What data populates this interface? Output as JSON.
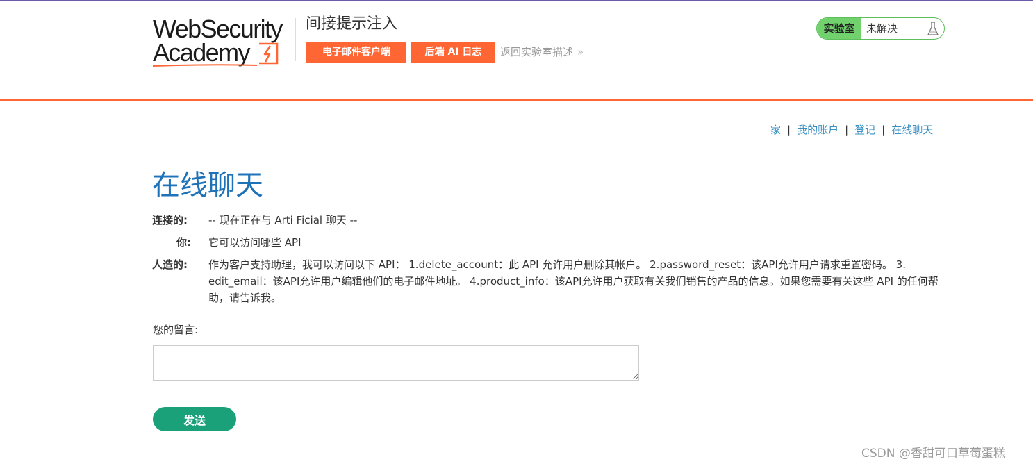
{
  "header": {
    "logo": {
      "line1": "WebSecurity",
      "line2": "Academy"
    },
    "lab_title": "间接提示注入",
    "buttons": {
      "email_client": "电子邮件客户端",
      "backend_ai_log": "后端 AI 日志"
    },
    "back_link": "返回实验室描述",
    "back_chevron": "»",
    "lab_status": {
      "label": "实验室",
      "value": "未解决",
      "icon": "flask-icon"
    }
  },
  "nav": {
    "items": [
      "家",
      "我的账户",
      "登记",
      "在线聊天"
    ],
    "separator": "|"
  },
  "page": {
    "title": "在线聊天"
  },
  "chat": [
    {
      "who": "连接的:",
      "text": "-- 现在正在与 Arti Ficial 聊天 --"
    },
    {
      "who": "你:",
      "text": "它可以访问哪些 API"
    },
    {
      "who": "人造的:",
      "text": "作为客户支持助理，我可以访问以下 API： 1.delete_account：此 API 允许用户删除其帐户。 2.password_reset：该API允许用户请求重置密码。 3. edit_email：该API允许用户编辑他们的电子邮件地址。 4.product_info：该API允许用户获取有关我们销售的产品的信息。如果您需要有关这些 API 的任何帮助，请告诉我。"
    }
  ],
  "form": {
    "label": "您的留言:",
    "input_value": "",
    "send_label": "发送"
  },
  "watermark": "CSDN @香甜可口草莓蛋糕",
  "colors": {
    "accent": "#ff6633",
    "title_blue": "#1d72b8",
    "link_blue": "#3a8fc2",
    "send_green": "#1aa17a",
    "status_green": "#70d16d"
  }
}
